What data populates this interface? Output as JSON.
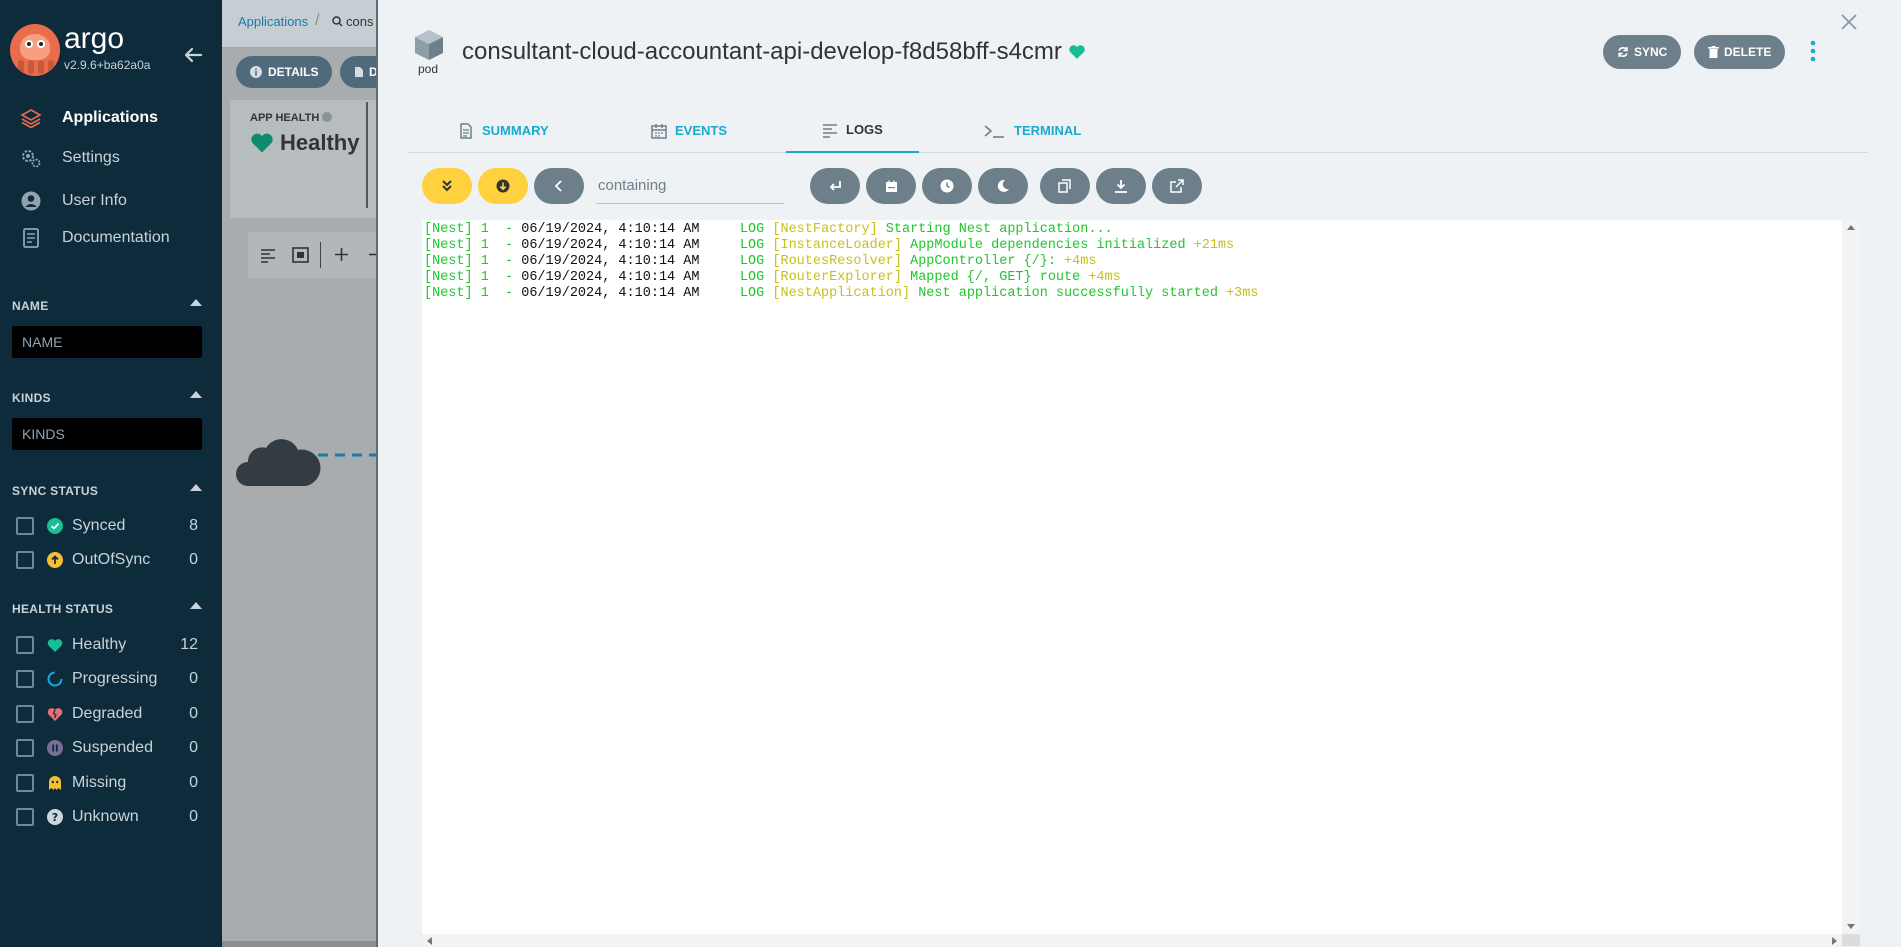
{
  "sidebar": {
    "logo_text": "argo",
    "version": "v2.9.6+ba62a0a",
    "nav": [
      {
        "label": "Applications",
        "icon": "layers-icon",
        "active": true
      },
      {
        "label": "Settings",
        "icon": "gears-icon",
        "active": false
      },
      {
        "label": "User Info",
        "icon": "user-circle-icon",
        "active": false
      },
      {
        "label": "Documentation",
        "icon": "book-icon",
        "active": false
      }
    ],
    "name_section": {
      "title": "NAME",
      "placeholder": "NAME"
    },
    "kinds_section": {
      "title": "KINDS",
      "placeholder": "KINDS"
    },
    "sync_section": {
      "title": "SYNC STATUS",
      "items": [
        {
          "label": "Synced",
          "count": "8",
          "icon": "check-circle-icon",
          "color": "#18be94"
        },
        {
          "label": "OutOfSync",
          "count": "0",
          "icon": "arrow-up-circle-icon",
          "color": "#f4c030"
        }
      ]
    },
    "health_section": {
      "title": "HEALTH STATUS",
      "items": [
        {
          "label": "Healthy",
          "count": "12",
          "icon": "heart-icon",
          "color": "#18be94"
        },
        {
          "label": "Progressing",
          "count": "0",
          "icon": "spinner-icon",
          "color": "#0dadea"
        },
        {
          "label": "Degraded",
          "count": "0",
          "icon": "broken-heart-icon",
          "color": "#e96d76"
        },
        {
          "label": "Suspended",
          "count": "0",
          "icon": "pause-circle-icon",
          "color": "#766f94"
        },
        {
          "label": "Missing",
          "count": "0",
          "icon": "ghost-icon",
          "color": "#f4c030"
        },
        {
          "label": "Unknown",
          "count": "0",
          "icon": "question-circle-icon",
          "color": "#ccd6dd"
        }
      ]
    }
  },
  "background": {
    "breadcrumb_root": "Applications",
    "breadcrumb_current": "cons",
    "details_label": "DETAILS",
    "second_btn": "D",
    "app_health_title": "APP HEALTH",
    "app_health_value": "Healthy"
  },
  "panel": {
    "kind_label": "pod",
    "title": "consultant-cloud-accountant-api-develop-f8d58bff-s4cmr",
    "sync_label": "SYNC",
    "delete_label": "DELETE",
    "tabs": [
      {
        "label": "SUMMARY",
        "icon": "file-icon",
        "active": false
      },
      {
        "label": "EVENTS",
        "icon": "calendar-icon",
        "active": false
      },
      {
        "label": "LOGS",
        "icon": "align-left-icon",
        "active": true
      },
      {
        "label": "TERMINAL",
        "icon": "terminal-icon",
        "active": false
      }
    ],
    "search_placeholder": "containing",
    "colors": {
      "accent": "#1aaacc",
      "toolbar_yellow": "#ffd13f",
      "toolbar_gray": "#6d7f8b"
    },
    "log_lines": [
      {
        "prefix": "[Nest] 1  - ",
        "time": "06/19/2024, 4:10:14 AM",
        "level": "     LOG ",
        "ctx": "[NestFactory]",
        "msg": " Starting Nest application...",
        "dur": ""
      },
      {
        "prefix": "[Nest] 1  - ",
        "time": "06/19/2024, 4:10:14 AM",
        "level": "     LOG ",
        "ctx": "[InstanceLoader]",
        "msg": " AppModule dependencies initialized",
        "dur": " +21ms"
      },
      {
        "prefix": "[Nest] 1  - ",
        "time": "06/19/2024, 4:10:14 AM",
        "level": "     LOG ",
        "ctx": "[RoutesResolver]",
        "msg": " AppController {/}:",
        "dur": " +4ms"
      },
      {
        "prefix": "[Nest] 1  - ",
        "time": "06/19/2024, 4:10:14 AM",
        "level": "     LOG ",
        "ctx": "[RouterExplorer]",
        "msg": " Mapped {/, GET} route",
        "dur": " +4ms"
      },
      {
        "prefix": "[Nest] 1  - ",
        "time": "06/19/2024, 4:10:14 AM",
        "level": "     LOG ",
        "ctx": "[NestApplication]",
        "msg": " Nest application successfully started",
        "dur": " +3ms"
      }
    ]
  }
}
